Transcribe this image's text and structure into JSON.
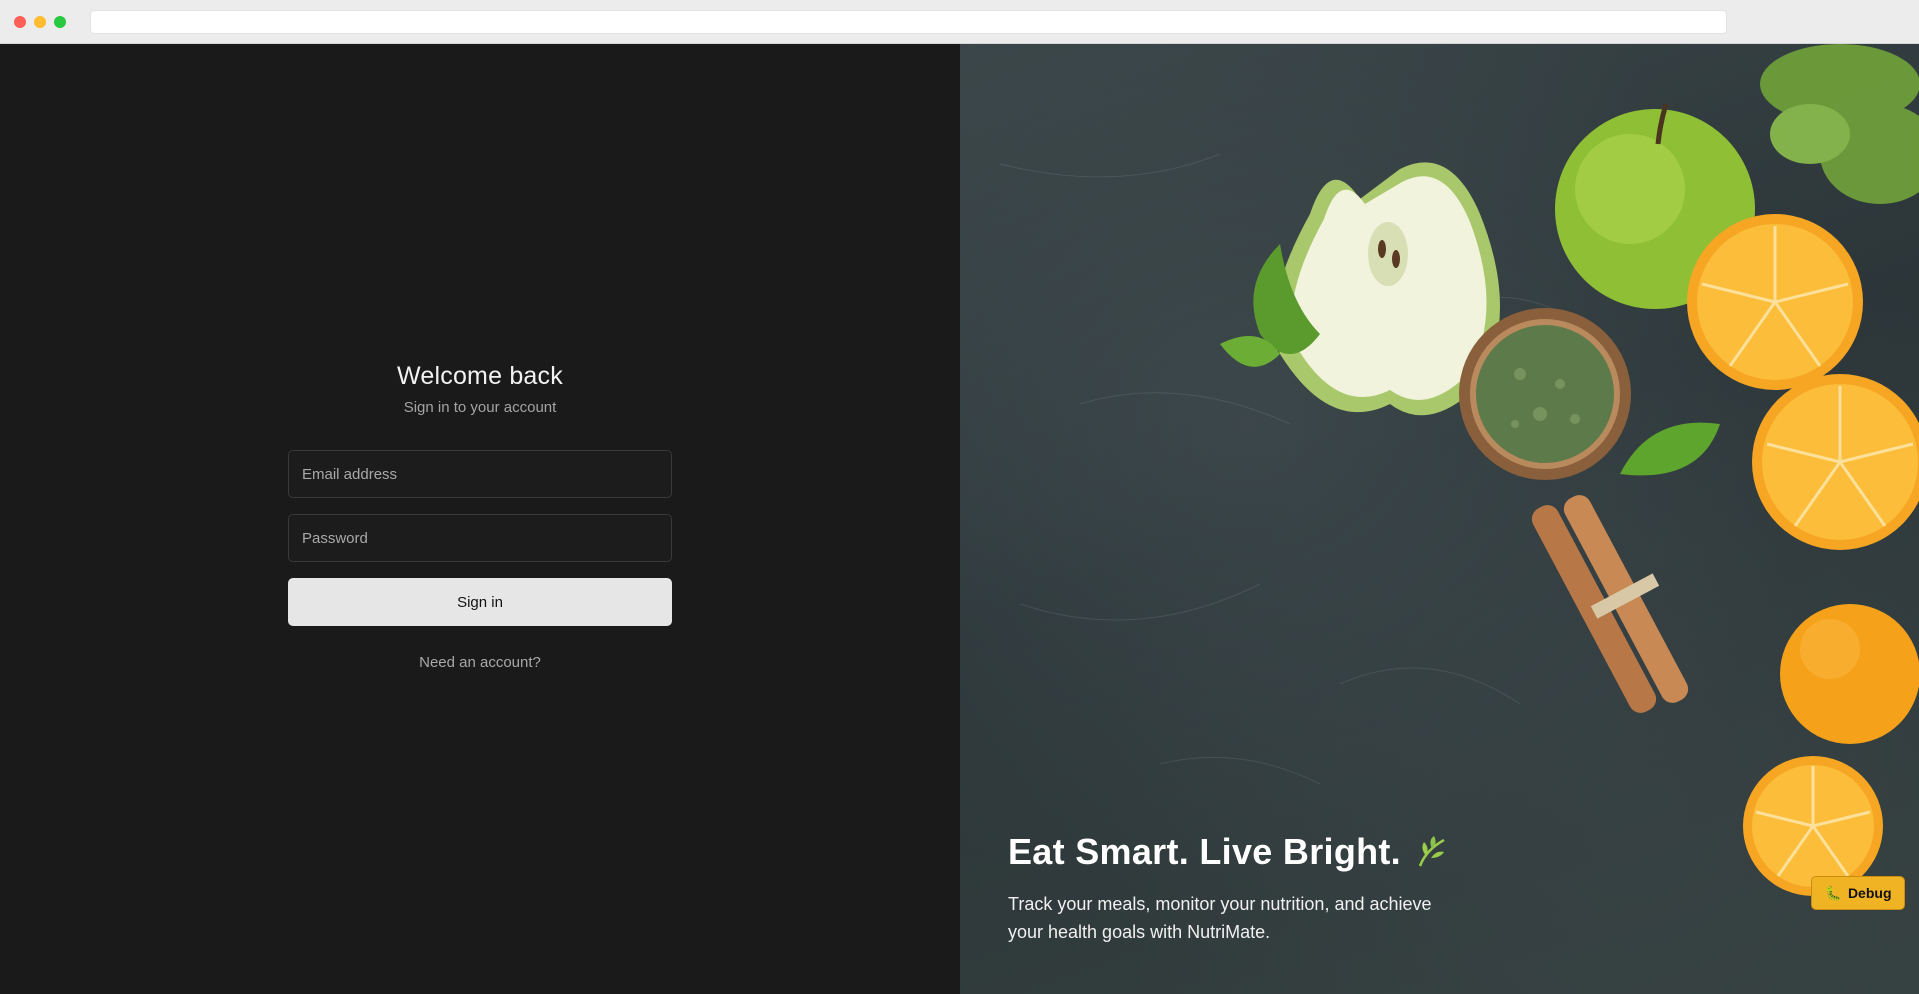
{
  "browser": {
    "url": ""
  },
  "auth": {
    "title": "Welcome back",
    "subtitle": "Sign in to your account",
    "email_placeholder": "Email address",
    "password_placeholder": "Password",
    "signin_label": "Sign in",
    "signup_link": "Need an account?"
  },
  "hero": {
    "tagline": "Eat Smart. Live Bright.",
    "tagline_icon": "leaf-icon",
    "description": "Track your meals, monitor your nutrition, and achieve your health goals with NutriMate.",
    "image_subject": "green apples, oranges, cinnamon sticks and dried herbs on dark stone"
  },
  "debug": {
    "label": "Debug",
    "icon": "bug-icon",
    "color": "#f0b323"
  },
  "colors": {
    "left_bg": "#1a1a1a",
    "button_bg": "#e6e6e6",
    "accent_green": "#8bc34a"
  }
}
